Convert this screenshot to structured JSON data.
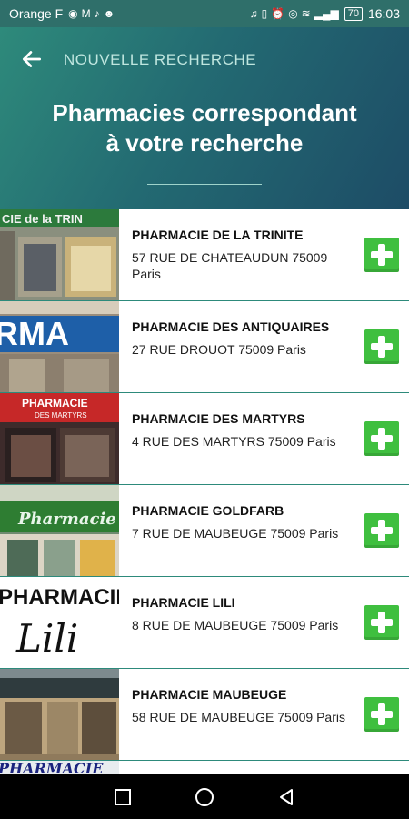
{
  "status_bar": {
    "carrier": "Orange F",
    "battery": "70",
    "time": "16:03"
  },
  "header": {
    "back_icon": "arrow-left-icon",
    "label": "NOUVELLE RECHERCHE",
    "title_line1": "Pharmacies correspondant",
    "title_line2": "à votre recherche"
  },
  "pharmacies": [
    {
      "name": "PHARMACIE DE LA TRINITE",
      "address": "57 RUE DE CHATEAUDUN 75009 Paris",
      "sign": "CIE de la TRIN"
    },
    {
      "name": "PHARMACIE DES ANTIQUAIRES",
      "address": "27 RUE DROUOT 75009 Paris",
      "sign": "RMA"
    },
    {
      "name": "PHARMACIE DES MARTYRS",
      "address": "4 RUE DES MARTYRS 75009 Paris",
      "sign": "PHARMACIE DES MARTYRS"
    },
    {
      "name": "PHARMACIE GOLDFARB",
      "address": "7 RUE DE MAUBEUGE 75009 Paris",
      "sign": "Pharmacie"
    },
    {
      "name": "PHARMACIE LILI",
      "address": "8 RUE DE MAUBEUGE 75009 Paris",
      "sign": "PHARMACIE Lili"
    },
    {
      "name": "PHARMACIE MAUBEUGE",
      "address": "58 RUE DE MAUBEUGE 75009 Paris",
      "sign": ""
    }
  ],
  "next_row_sign": "PHARMACIE",
  "colors": {
    "header_start": "#2e8a7b",
    "header_end": "#1d4c66",
    "add_button": "#3fbf3f",
    "row_divider": "#2d8a7b"
  }
}
